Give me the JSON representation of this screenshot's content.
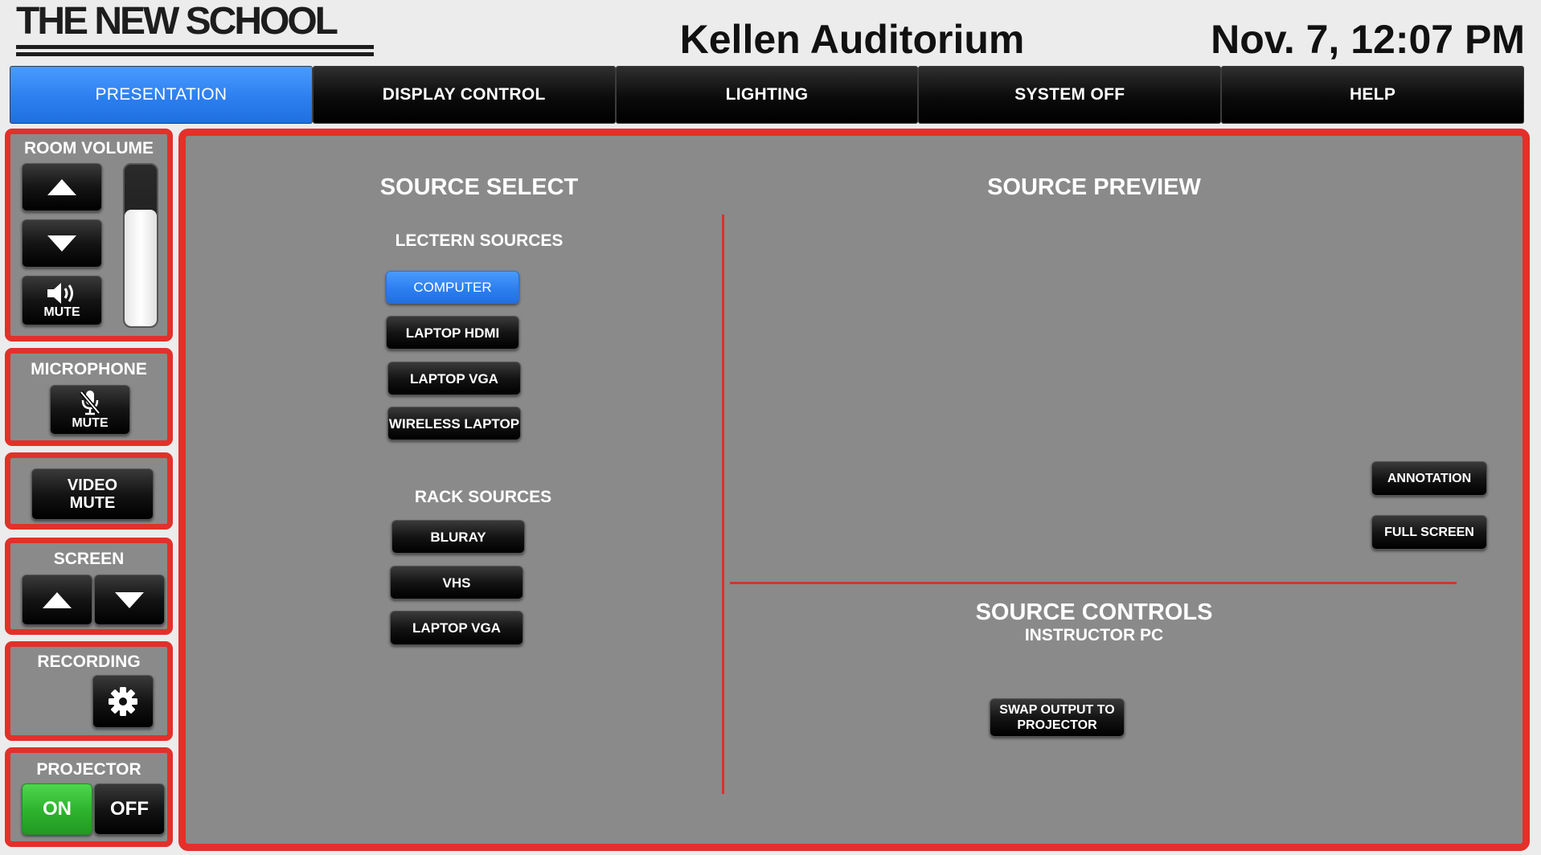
{
  "header": {
    "logo_text": "THE NEW SCHOOL",
    "room_name": "Kellen Auditorium",
    "datetime": "Nov. 7, 12:07 PM"
  },
  "tabs": [
    {
      "label": "PRESENTATION",
      "active": true
    },
    {
      "label": "DISPLAY CONTROL",
      "active": false
    },
    {
      "label": "LIGHTING",
      "active": false
    },
    {
      "label": "SYSTEM OFF",
      "active": false
    },
    {
      "label": "HELP",
      "active": false
    }
  ],
  "sidebar": {
    "room_volume": {
      "label": "ROOM VOLUME",
      "mute_label": "MUTE",
      "level_fraction": 0.72
    },
    "microphone": {
      "label": "MICROPHONE",
      "mute_label": "MUTE"
    },
    "video_mute": {
      "label_line1": "VIDEO",
      "label_line2": "MUTE"
    },
    "screen": {
      "label": "SCREEN"
    },
    "recording": {
      "label": "RECORDING"
    },
    "projector": {
      "label": "PROJECTOR",
      "on_label": "ON",
      "off_label": "OFF",
      "state": "on"
    }
  },
  "main": {
    "source_select": {
      "title": "SOURCE SELECT",
      "lectern_heading": "LECTERN SOURCES",
      "lectern_sources": [
        "COMPUTER",
        "LAPTOP HDMI",
        "LAPTOP VGA",
        "WIRELESS LAPTOP"
      ],
      "active_source": "COMPUTER",
      "rack_heading": "RACK SOURCES",
      "rack_sources": [
        "BLURAY",
        "VHS",
        "LAPTOP VGA"
      ]
    },
    "source_preview": {
      "title": "SOURCE PREVIEW",
      "annotation_label": "ANNOTATION",
      "fullscreen_label": "FULL SCREEN"
    },
    "source_controls": {
      "title": "SOURCE CONTROLS",
      "subtitle": "INSTRUCTOR PC",
      "swap_label_line1": "SWAP OUTPUT TO",
      "swap_label_line2": "PROJECTOR"
    }
  },
  "colors": {
    "accent_blue": "#2d7ff0",
    "border_red": "#e3302a",
    "panel_gray": "#8a8a8a",
    "on_green": "#2fb52f"
  }
}
